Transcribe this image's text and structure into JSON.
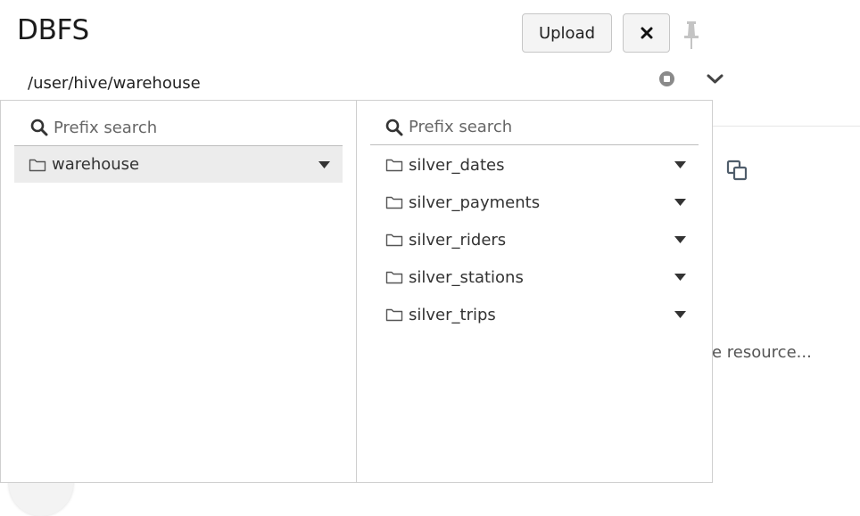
{
  "header": {
    "title": "DBFS",
    "upload_label": "Upload",
    "path": "/user/hive/warehouse"
  },
  "background": {
    "resource_text": "e resource..."
  },
  "left_column": {
    "search_placeholder": "Prefix search",
    "items": [
      {
        "label": "warehouse",
        "selected": true
      }
    ]
  },
  "right_column": {
    "search_placeholder": "Prefix search",
    "items": [
      {
        "label": "silver_dates"
      },
      {
        "label": "silver_payments"
      },
      {
        "label": "silver_riders"
      },
      {
        "label": "silver_stations"
      },
      {
        "label": "silver_trips"
      }
    ]
  },
  "icons": {
    "close": "close-icon",
    "pin": "pin-icon",
    "stop": "stop-icon",
    "chevron": "chevron-down-icon",
    "search": "search-icon",
    "folder": "folder-icon",
    "caret": "caret-down-icon",
    "copy": "copy-icon"
  },
  "colors": {
    "selected_bg": "#ececec",
    "border": "#cfcfcf",
    "icon_slate": "#4f5d6b"
  }
}
